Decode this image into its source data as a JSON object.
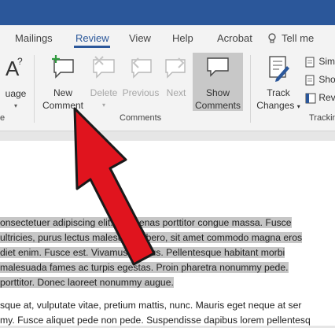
{
  "tabs": [
    {
      "label": "Mailings"
    },
    {
      "label": "Review"
    },
    {
      "label": "View"
    },
    {
      "label": "Help"
    },
    {
      "label": "Acrobat"
    },
    {
      "label": "Tell me"
    }
  ],
  "ribbon": {
    "language_label": "uage",
    "language_group_label": "e",
    "new_comment": [
      "New",
      "Comment"
    ],
    "delete_label": "Delete",
    "previous_label": "Previous",
    "next_label": "Next",
    "show_comments": [
      "Show",
      "Comments"
    ],
    "comments_group_label": "Comments",
    "track_changes": [
      "Track",
      "Changes"
    ],
    "simple_markup": "Sim",
    "show_markup": "Sho",
    "reviewing_pane": "Rev",
    "tracking_group_label": "Trackin"
  },
  "document": {
    "paragraph1": [
      "onsectetuer adipiscing elit. Maecenas porttitor congue massa. Fusce",
      "ultricies, purus lectus malesuada libero, sit amet commodo magna eros",
      "diet enim. Fusce est. Vivamus a tellus. Pellentesque habitant morbi",
      "malesuada fames ac turpis egestas. Proin pharetra nonummy pede.",
      "porttitor. Donec laoreet nonummy augue."
    ],
    "paragraph2": [
      "sque at, vulputate vitae, pretium mattis, nunc. Mauris eget neque at ser",
      "my. Fusce aliquet pede non pede. Suspendisse dapibus lorem pellentesq"
    ]
  },
  "colors": {
    "accent": "#2b579a",
    "arrow": "#e0141e",
    "selection": "#c6c6c6"
  }
}
